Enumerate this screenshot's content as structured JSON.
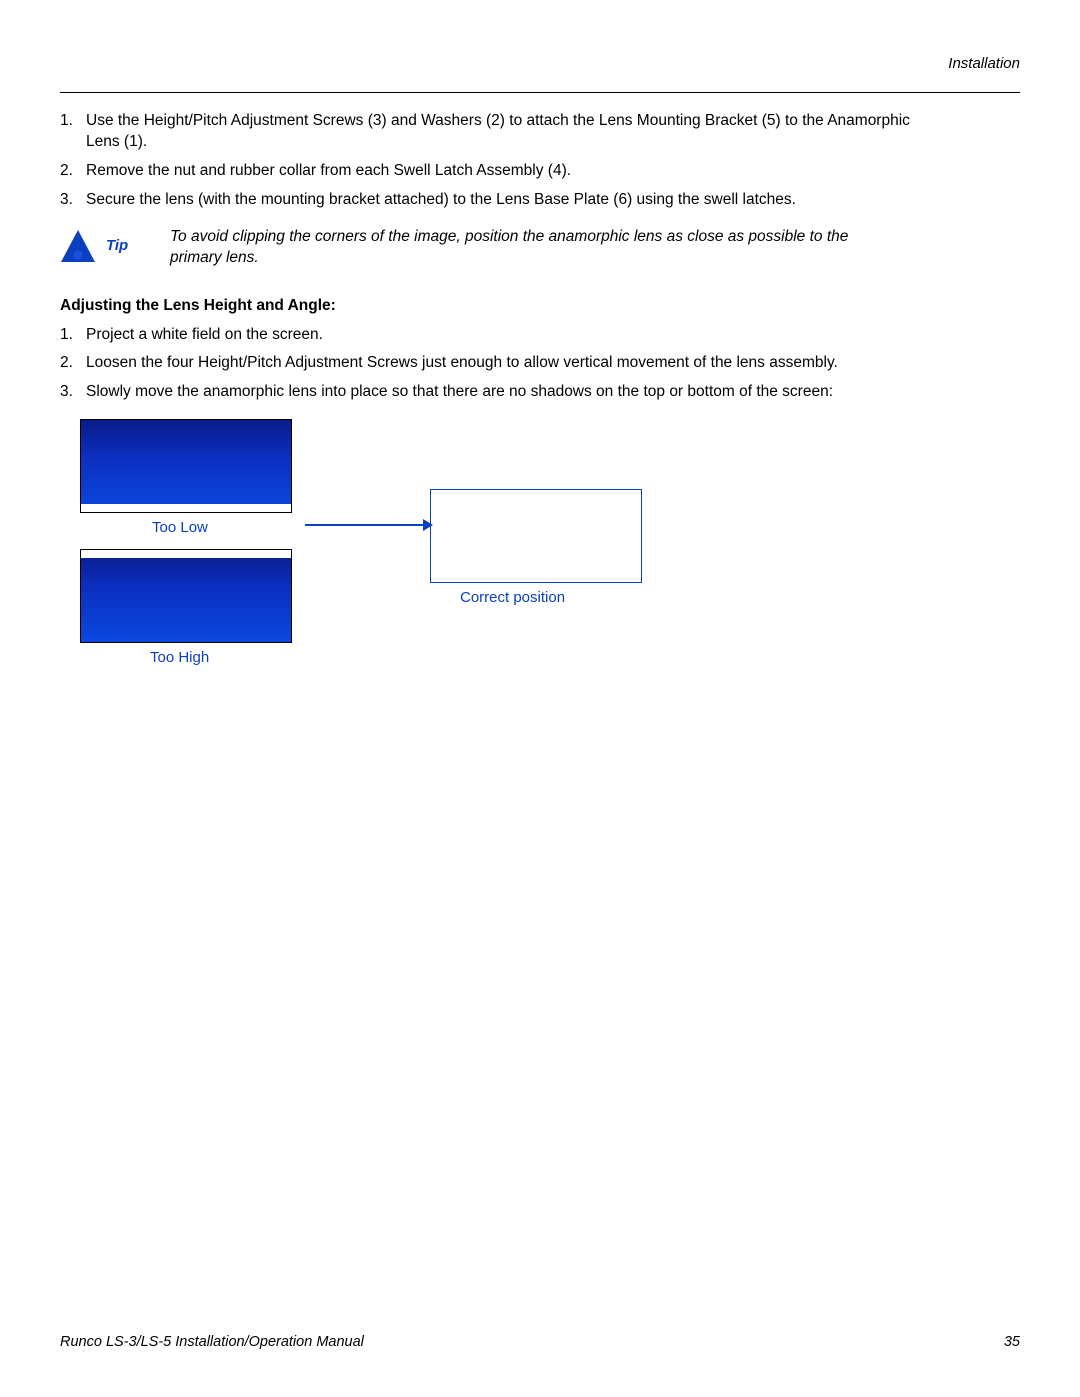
{
  "header": {
    "section": "Installation"
  },
  "list1": {
    "i1": {
      "n": "1.",
      "t": "Use the Height/Pitch Adjustment Screws (3) and Washers (2) to attach the Lens Mounting Bracket (5) to the Anamorphic Lens (1)."
    },
    "i2": {
      "n": "2.",
      "t": "Remove the nut and rubber collar from each Swell Latch Assembly (4)."
    },
    "i3": {
      "n": "3.",
      "t": "Secure the lens (with the mounting bracket attached) to the Lens Base Plate (6) using the swell latches."
    }
  },
  "tip": {
    "label": "Tip",
    "text": "To avoid clipping the corners of the image, position the anamorphic lens as close as possible to the primary lens."
  },
  "heading2": "Adjusting the Lens Height and Angle:",
  "list2": {
    "i1": {
      "n": "1.",
      "t": "Project a white field on the screen."
    },
    "i2": {
      "n": "2.",
      "t": "Loosen the four Height/Pitch Adjustment Screws just enough to allow vertical movement of the lens assembly."
    },
    "i3": {
      "n": "3.",
      "t": "Slowly move the anamorphic lens into place so that there are no shadows on the top or bottom of the screen:"
    }
  },
  "diagram": {
    "too_low": "Too Low",
    "too_high": "Too High",
    "correct": "Correct position"
  },
  "footer": {
    "title": "Runco LS-3/LS-5 Installation/Operation Manual",
    "page": "35"
  }
}
